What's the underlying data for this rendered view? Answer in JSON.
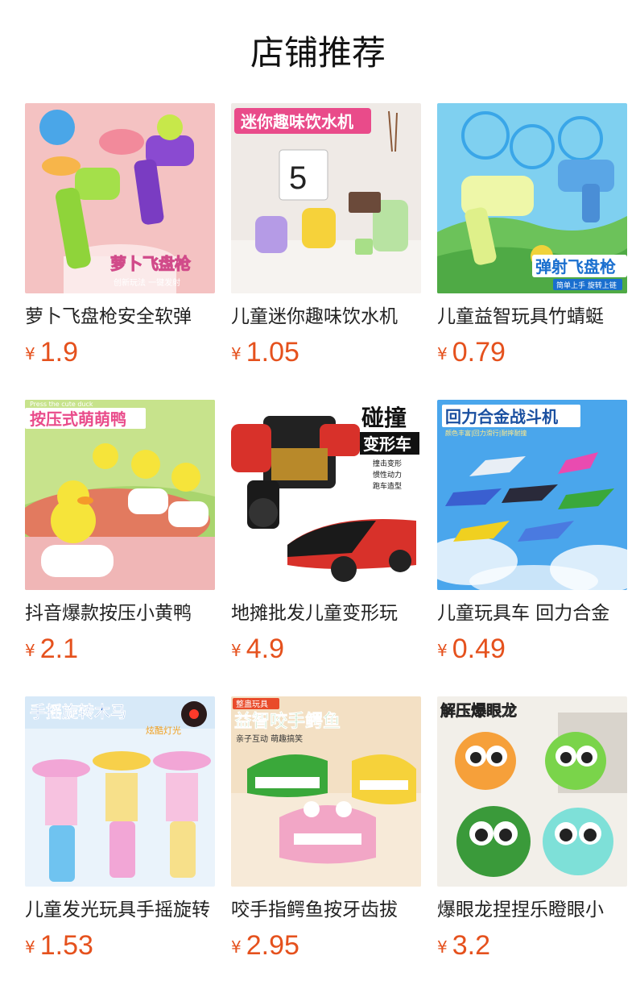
{
  "page_title": "店铺推荐",
  "currency_symbol": "¥",
  "products": [
    {
      "name": "萝卜飞盘枪安全软弹",
      "price": "1.9",
      "image_title": "萝卜飞盘枪",
      "image_subtitle": "创新玩法 一键发射"
    },
    {
      "name": "儿童迷你趣味饮水机",
      "price": "1.05",
      "image_title": "迷你趣味饮水机",
      "image_subtitle": "5"
    },
    {
      "name": "儿童益智玩具竹蜻蜓",
      "price": "0.79",
      "image_title": "弹射飞盘枪",
      "image_subtitle": "简单上手  旋转上链"
    },
    {
      "name": "抖音爆款按压小黄鸭",
      "price": "2.1",
      "image_title": "按压式萌萌鸭",
      "image_subtitle": "Press the cute duck"
    },
    {
      "name": "地摊批发儿童变形玩",
      "price": "4.9",
      "image_title": "碰撞",
      "image_subtitle": "变形车",
      "image_notes": [
        "撞击变形",
        "惯性动力",
        "跑车造型"
      ]
    },
    {
      "name": "儿童玩具车 回力合金",
      "price": "0.49",
      "image_title": "回力合金战斗机",
      "image_subtitle": "颜色丰富|回力滑行|耐摔耐撞"
    },
    {
      "name": "儿童发光玩具手摇旋转",
      "price": "1.53",
      "image_title": "手摇旋转木马",
      "image_subtitle": "炫酷灯光"
    },
    {
      "name": "咬手指鳄鱼按牙齿拔",
      "price": "2.95",
      "image_title": "益智咬手鳄鱼",
      "image_subtitle": "亲子互动 萌趣搞笑",
      "image_tag": "整蛊玩具"
    },
    {
      "name": "爆眼龙捏捏乐瞪眼小",
      "price": "3.2",
      "image_title": "解压爆眼龙",
      "image_subtitle": ""
    }
  ],
  "colors": {
    "price": "#e5511d",
    "title": "#111111",
    "name": "#222222"
  }
}
